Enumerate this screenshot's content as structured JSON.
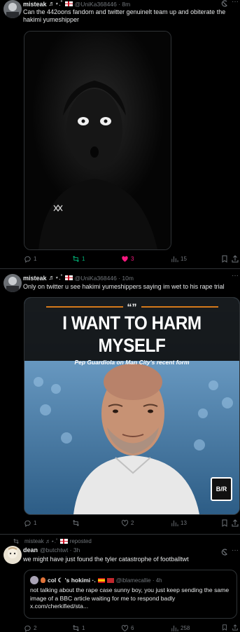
{
  "tweets": [
    {
      "author": "misteak",
      "name_symbols": "♬⋆.˚",
      "handle_meta": "@UniKa368446 · 8m",
      "text": "Can the 442oons fandom and twitter genuinelt team up and obiterate the hakimi yumeshipper",
      "actions": {
        "replies": "1",
        "retweets": "1",
        "likes": "3",
        "views": "15"
      }
    },
    {
      "author": "misteak",
      "name_symbols": "♬⋆.˚",
      "handle_meta": "@UniKa368446 · 10m",
      "text": "Only on twitter u see hakimi yumeshippers saying im wet to his rape trial",
      "image": {
        "quote_mark": "“”",
        "headline": "I WANT TO HARM MYSELF",
        "subheadline": "Pep Guardiola on Man City's recent form",
        "badge": "B/R"
      },
      "actions": {
        "replies": "1",
        "retweets": "",
        "likes": "2",
        "views": "13"
      }
    },
    {
      "repost_label": "misteak ♬⋆.˚",
      "repost_suffix": "reposted",
      "author": "dean",
      "handle_meta": "@butchtwt · 3h",
      "text": "we might have just found the tyler catastrophe of footballtwt",
      "quote": {
        "author": "col ☾ 's hokimi ·.",
        "handle_meta": "@iblamecallie · 4h",
        "text": "not talking about the rape case sunny boy, you just keep sending the same image of a BBC article waiting for me to respond badly x.com/cherkified/sta..."
      },
      "actions": {
        "replies": "2",
        "retweets": "1",
        "likes": "6",
        "views": "258"
      }
    }
  ],
  "colors": {
    "background": "#000000",
    "text": "#e7e9ea",
    "muted": "#71767b",
    "divider": "#2f3336",
    "retweet_active": "#00ba7c",
    "like_active": "#f91880"
  },
  "icons": [
    "grok-icon",
    "more-icon",
    "reply-icon",
    "retweet-icon",
    "like-icon",
    "views-icon",
    "bookmark-icon",
    "share-icon"
  ]
}
